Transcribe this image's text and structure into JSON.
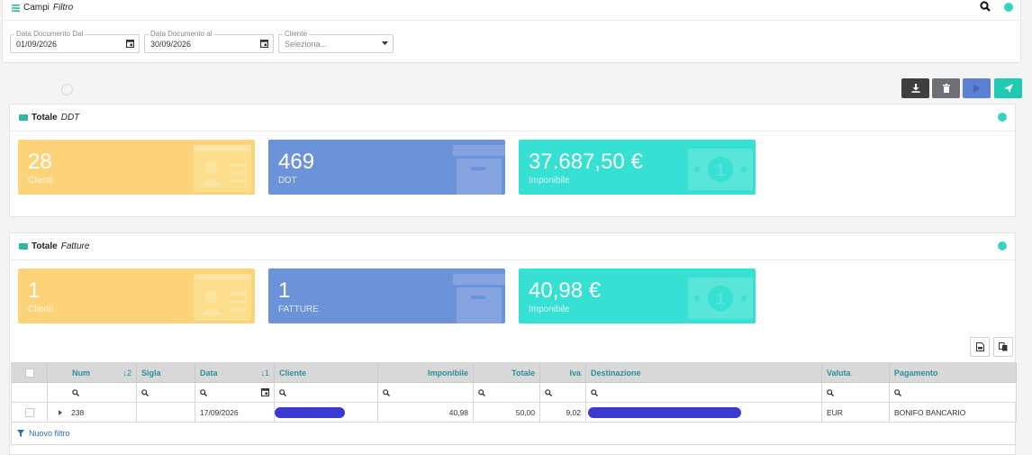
{
  "filter_panel": {
    "title": "Campi",
    "title_em": "Filtro",
    "fields": {
      "date_from": {
        "label": "Data Documento Dal",
        "value": "01/09/2026"
      },
      "date_to": {
        "label": "Data Documento al",
        "value": "30/09/2026"
      },
      "client": {
        "label": "Cliente",
        "placeholder": "Seleziona..."
      }
    }
  },
  "toolbar": {
    "buttons": [
      {
        "icon": "download-icon",
        "color": "#3f3f3f"
      },
      {
        "icon": "trash-icon",
        "color": "#6c6f73"
      },
      {
        "icon": "play-icon",
        "color": "#5a7fd4"
      },
      {
        "icon": "send-icon",
        "color": "#20c9b4"
      }
    ]
  },
  "ddt_panel": {
    "title": "Totale",
    "title_em": "DDT",
    "stats": [
      {
        "value": "28",
        "label": "Clienti",
        "icon": "id-card-icon",
        "color": "#fdd37a"
      },
      {
        "value": "469",
        "label": "DDT",
        "icon": "archive-box-icon",
        "color": "#6c93d7"
      },
      {
        "value": "37.687,50 €",
        "label": "Imponibile",
        "icon": "banknote-icon",
        "color": "#36e0d3"
      }
    ]
  },
  "fatture_panel": {
    "title": "Totale",
    "title_em": "Fatture",
    "stats": [
      {
        "value": "1",
        "label": "Clienti",
        "icon": "id-card-icon",
        "color": "#fdd37a"
      },
      {
        "value": "1",
        "label": "FATTURE",
        "icon": "archive-box-icon",
        "color": "#6c93d7"
      },
      {
        "value": "40,98 €",
        "label": "Imponibile",
        "icon": "banknote-icon",
        "color": "#36e0d3"
      }
    ]
  },
  "table": {
    "headers": {
      "num": "Num",
      "num_sort": "↓2",
      "sigla": "Sigla",
      "data": "Data",
      "data_sort": "↓1",
      "cliente": "Cliente",
      "imponibile": "Imponibile",
      "totale": "Totale",
      "iva": "Iva",
      "destinazione": "Destinazione",
      "valuta": "Valuta",
      "pagamento": "Pagamento"
    },
    "rows": [
      {
        "num": "238",
        "sigla": "",
        "data": "17/09/2026",
        "imponibile": "40,98",
        "totale": "50,00",
        "iva": "9,02",
        "valuta": "EUR",
        "pagamento": "BONIFO BANCARIO"
      }
    ],
    "new_filter": "Nuovo filtro"
  },
  "colors": {
    "accent": "#2c8e9e",
    "status_dot": "#35d3c0",
    "link": "#2e6fb5"
  }
}
